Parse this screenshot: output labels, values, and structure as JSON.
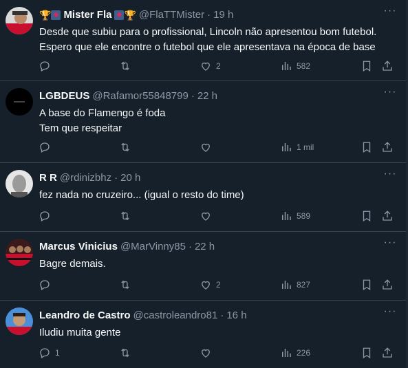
{
  "tweets": [
    {
      "name": "Mister Fla",
      "handle": "@FlaTTMister",
      "time": "19 h",
      "badges": true,
      "lines": [
        "Desde que subiu para o profissional, Lincoln não apresentou bom futebol.",
        "Espero que ele encontre o futebol que ele apresentava na época de base"
      ],
      "replies": "",
      "retweets": "",
      "likes": "2",
      "views": "582",
      "avatar": "red-portrait"
    },
    {
      "name": "LGBDEUS",
      "handle": "@Rafamor55848799",
      "time": "22 h",
      "badges": false,
      "lines": [
        "A base do Flamengo é foda",
        "Tem que respeitar"
      ],
      "replies": "",
      "retweets": "",
      "likes": "",
      "views": "1 mil",
      "avatar": "black"
    },
    {
      "name": "R R",
      "handle": "@rdinizbhz",
      "time": "20 h",
      "badges": false,
      "lines": [
        "fez nada no cruzeiro... (igual o resto do time)"
      ],
      "replies": "",
      "retweets": "",
      "likes": "",
      "views": "589",
      "avatar": "grey-face"
    },
    {
      "name": "Marcus Vinicius",
      "handle": "@MarVinny85",
      "time": "22 h",
      "badges": false,
      "lines": [
        "Bagre demais."
      ],
      "replies": "",
      "retweets": "",
      "likes": "2",
      "views": "827",
      "avatar": "red-group"
    },
    {
      "name": "Leandro de Castro",
      "handle": "@castroleandro81",
      "time": "16 h",
      "badges": false,
      "lines": [
        "Iludiu muita gente"
      ],
      "replies": "1",
      "retweets": "",
      "likes": "",
      "views": "226",
      "avatar": "blue-face"
    }
  ],
  "icons": [
    "reply-icon",
    "retweet-icon",
    "like-icon",
    "views-icon",
    "bookmark-icon",
    "share-icon",
    "more-icon",
    "trophy-icon",
    "flag-icon"
  ],
  "colors": {
    "background": "#15202b",
    "text": "#f7f9f9",
    "muted": "#8b98a5",
    "divider": "#38444d"
  }
}
